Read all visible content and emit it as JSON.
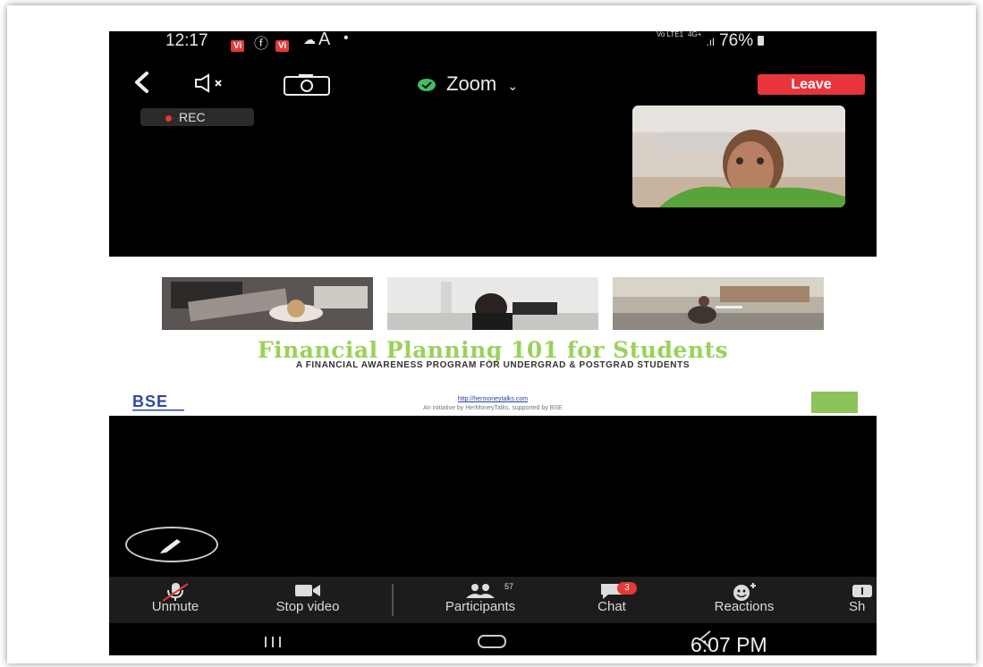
{
  "status_bar": {
    "time": "12:17",
    "badge1": "Vi",
    "badge2": "Vi",
    "network": "Vo LTE1",
    "network2": "4G+",
    "battery": "76%"
  },
  "toolbar": {
    "title": "Zoom",
    "leave_label": "Leave"
  },
  "recording": {
    "label": "REC"
  },
  "slide": {
    "title": "Financial Planning 101 for Students",
    "subtitle": "A FINANCIAL AWARENESS PROGRAM FOR UNDERGRAD & POSTGRAD STUDENTS",
    "link": "http://hermoneytalks.com",
    "initiative": "An initiative by HerMoneyTalks, supported by BSE",
    "logo_left": "BSE",
    "colors": {
      "title": "#9bd15b"
    }
  },
  "bottom_bar": {
    "items": [
      {
        "label": "Unmute",
        "icon": "muted-mic-icon"
      },
      {
        "label": "Stop video",
        "icon": "video-camera-icon"
      },
      {
        "label": "Participants",
        "icon": "participants-icon",
        "count": "57"
      },
      {
        "label": "Chat",
        "icon": "chat-icon",
        "badge": "3"
      },
      {
        "label": "Reactions",
        "icon": "reaction-smiley-icon"
      },
      {
        "label": "Sh",
        "icon": "share-icon"
      }
    ]
  },
  "overlay": {
    "clock": "6:07 PM"
  },
  "colors": {
    "leave": "#e8353b",
    "shield": "#3fbf5f",
    "badge": "#e53935"
  }
}
